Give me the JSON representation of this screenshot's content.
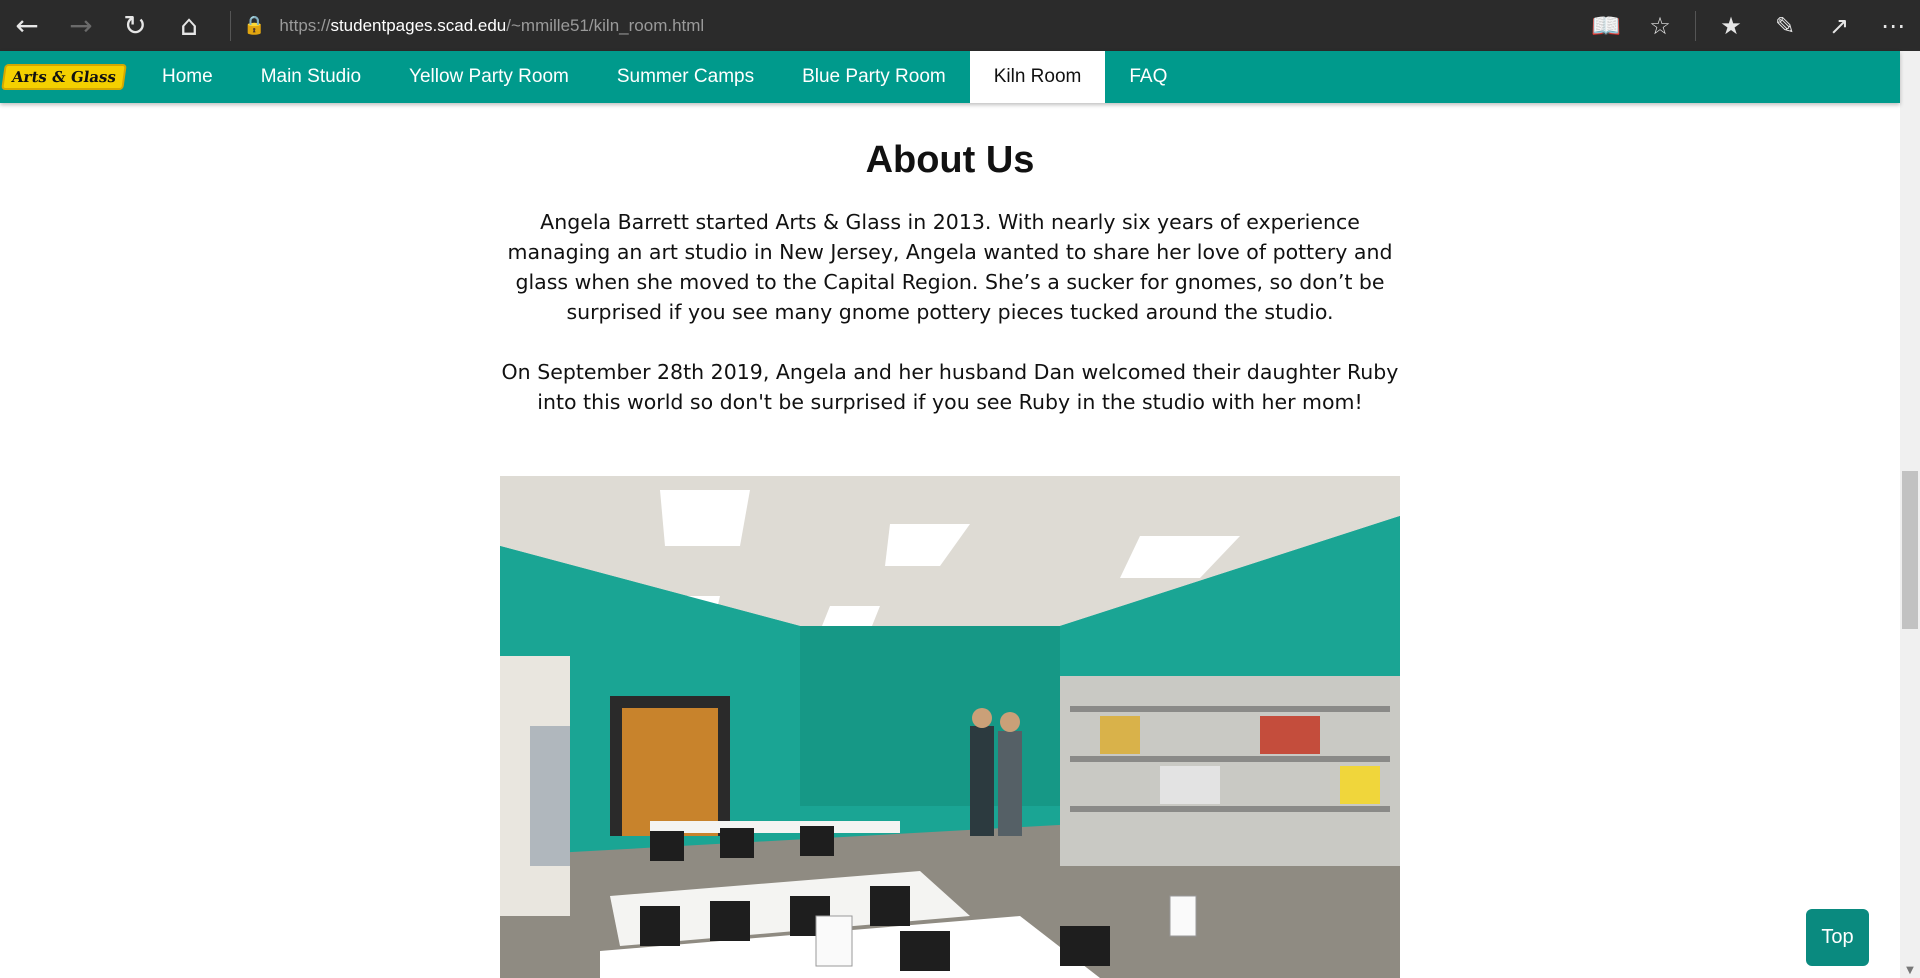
{
  "browser": {
    "url_scheme": "https://",
    "url_host": "studentpages.scad.edu",
    "url_path": "/~mmille51/kiln_room.html",
    "icons": {
      "back": "back-arrow-icon",
      "forward": "forward-arrow-icon",
      "refresh": "refresh-icon",
      "home": "home-icon",
      "lock": "lock-icon",
      "reading_view": "reading-view-icon",
      "favorite": "star-icon",
      "favorites_hub": "favorites-list-icon",
      "notes": "pen-icon",
      "share": "share-icon",
      "more": "more-icon"
    }
  },
  "site": {
    "logo_text": "Arts & Glass",
    "nav": [
      {
        "label": "Home",
        "active": false
      },
      {
        "label": "Main Studio",
        "active": false
      },
      {
        "label": "Yellow Party Room",
        "active": false
      },
      {
        "label": "Summer Camps",
        "active": false
      },
      {
        "label": "Blue Party Room",
        "active": false
      },
      {
        "label": "Kiln Room",
        "active": true
      },
      {
        "label": "FAQ",
        "active": false
      }
    ],
    "accent_color": "#009a8c"
  },
  "main": {
    "heading": "About Us",
    "paragraph1": "Angela Barrett started Arts & Glass in 2013. With nearly six years of experience managing an art studio in New Jersey, Angela wanted to share her love of pottery and glass when she moved to the Capital Region. She’s a sucker for gnomes, so don’t be surprised if you see many gnome pottery pieces tucked around the studio.",
    "paragraph2": "On September 28th 2019, Angela and her husband Dan welcomed their daughter Ruby into this world so don't be surprised if you see Ruby in the studio with her mom!"
  },
  "top_button": {
    "label": "Top"
  }
}
